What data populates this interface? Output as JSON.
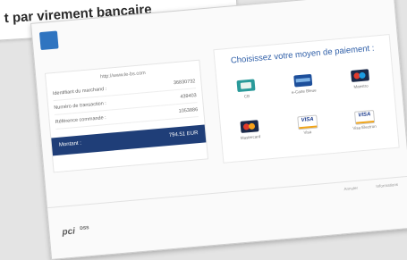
{
  "header": {
    "title": "t par virement bancaire"
  },
  "bank": {
    "logo_icon": "bank-logo-icon",
    "logo_letter": "",
    "brand_color": "#2f74c0"
  },
  "order": {
    "merchant_url": "http://www.le-bs.com",
    "rows": [
      {
        "label": "Identifiant du marchand :",
        "value": "36830732"
      },
      {
        "label": "Numéro de transaction :",
        "value": "439403"
      },
      {
        "label": "Référence commande :",
        "value": "1053886"
      }
    ],
    "amount_label": "Montant :",
    "amount_value": "794.51 EUR",
    "amount_bar_color": "#1f3e78"
  },
  "payment": {
    "title": "Choisissez votre moyen de paiement :",
    "methods": [
      {
        "name": "CB",
        "icon": "cb-card-icon"
      },
      {
        "name": "e-Carte Bleue",
        "icon": "e-carte-bleue-icon"
      },
      {
        "name": "Maestro",
        "icon": "maestro-icon"
      },
      {
        "name": "Mastercard",
        "icon": "mastercard-icon"
      },
      {
        "name": "Visa",
        "icon": "visa-icon"
      },
      {
        "name": "Visa Electron",
        "icon": "visa-electron-icon"
      }
    ]
  },
  "footer": {
    "link1": "Annuler",
    "link2": "Informations",
    "badge_main": "pci",
    "badge_sub": "DSS"
  }
}
